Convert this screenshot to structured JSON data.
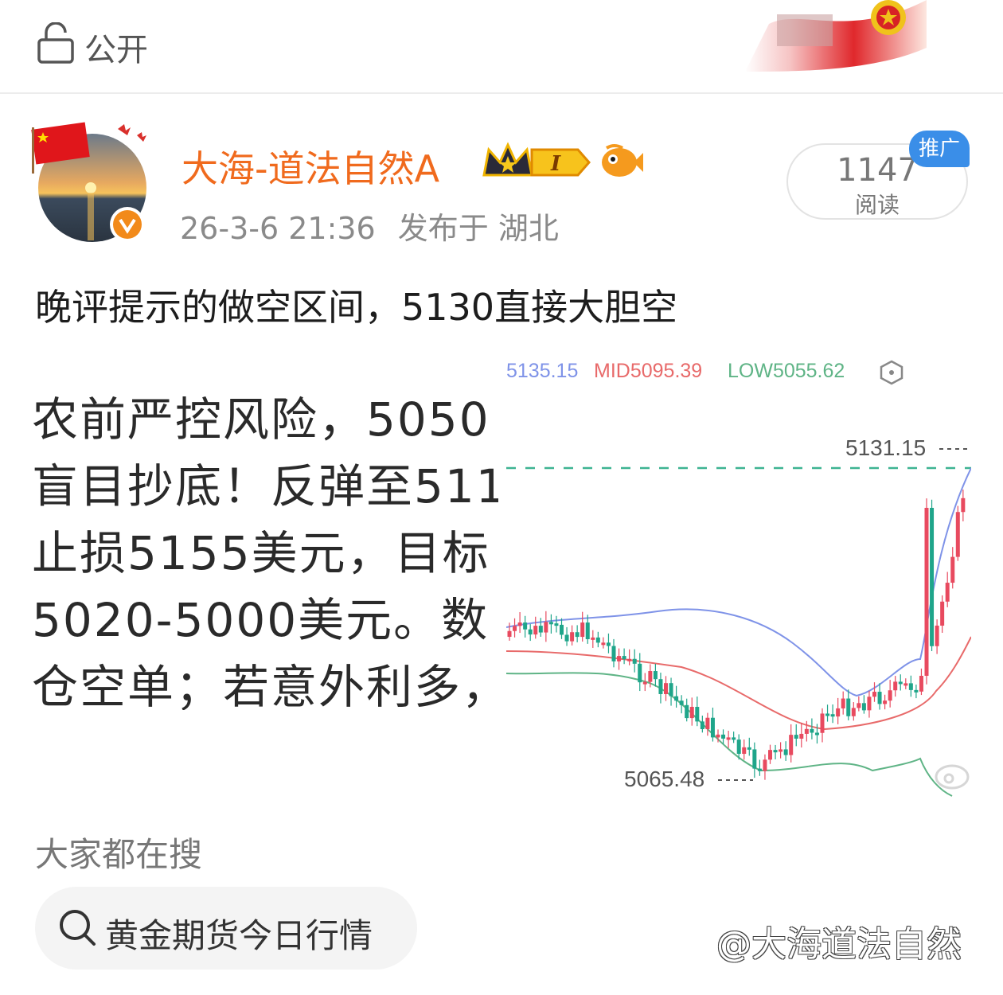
{
  "header": {
    "visibility_icon": "lock-icon",
    "visibility_label": "公开"
  },
  "post": {
    "author": "大海-道法自然A",
    "level_badge": "I",
    "timestamp": "26-3-6 21:36",
    "location": "发布于 湖北",
    "reads_count": "1147",
    "reads_label": "阅读",
    "promo_badge": "推广",
    "text": "晚评提示的做空区间，5130直接大胆空",
    "image_text_lines": [
      "农前严控风险，5050",
      "盲目抄底！反弹至511",
      "止损5155美元，目标",
      "5020-5000美元。数",
      "仓空单；若意外利多，"
    ]
  },
  "chart": {
    "legend_up": "5135.15",
    "legend_mid": "MID5095.39",
    "legend_low": "LOW5055.62",
    "high_marker": "5131.15",
    "low_marker": "5065.48",
    "colors": {
      "up": "#e84a5f",
      "down": "#1fa58a",
      "upper_band": "#7f93e8",
      "mid_band": "#e86a6a",
      "lower_band": "#5fb486"
    }
  },
  "chart_data": {
    "type": "candlestick",
    "upper_band_label": "5135.15",
    "mid_band_label": "MID5095.39",
    "low_band_label": "LOW5055.62",
    "max_marked": 5131.15,
    "min_marked": 5065.48,
    "ylim": [
      5040,
      5150
    ]
  },
  "hot_search": {
    "title": "大家都在搜",
    "query": "黄金期货今日行情"
  },
  "watermark": "@大海道法自然"
}
